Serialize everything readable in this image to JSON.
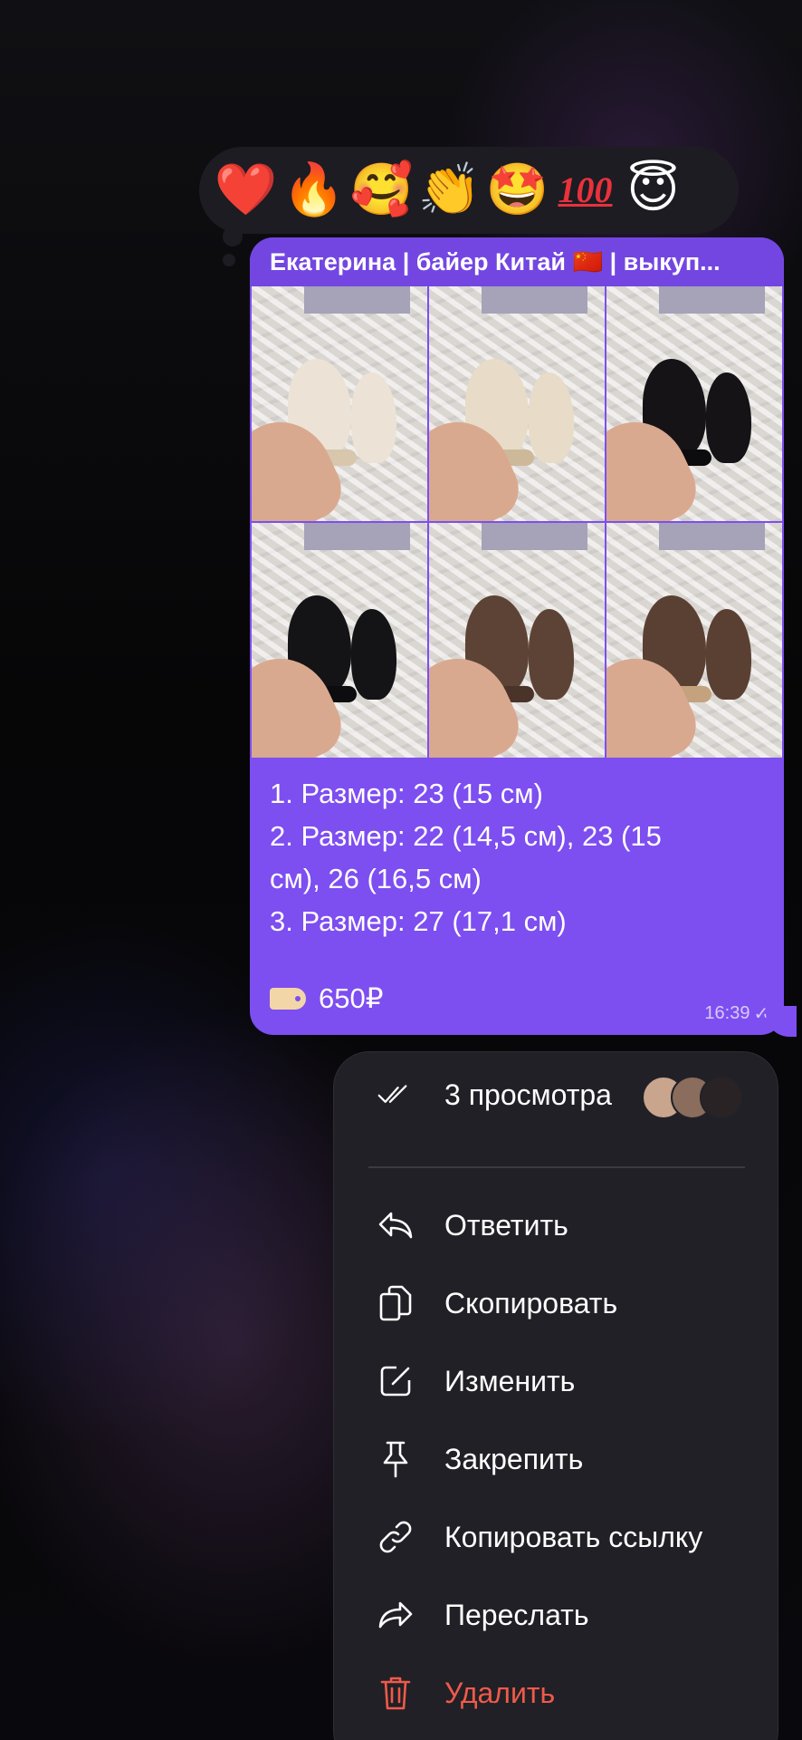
{
  "reactions": [
    {
      "glyph": "❤️",
      "name": "heart"
    },
    {
      "glyph": "🔥",
      "name": "fire"
    },
    {
      "glyph": "🥰",
      "name": "smiling-hearts"
    },
    {
      "glyph": "👏",
      "name": "clap"
    },
    {
      "glyph": "🤩",
      "name": "star-struck"
    },
    {
      "glyph": "100",
      "name": "hundred"
    },
    {
      "glyph": "😇",
      "name": "halo"
    }
  ],
  "message": {
    "sender": "Екатерина | байер Китай 🇨🇳 | выкуп...",
    "photos": [
      {
        "shoe": "#ece3d6",
        "sole": "#d8c7ad"
      },
      {
        "shoe": "#e8dcc8",
        "sole": "#cdb999"
      },
      {
        "shoe": "#151316",
        "sole": "#0c0b0d"
      },
      {
        "shoe": "#141315",
        "sole": "#0d0c0e"
      },
      {
        "shoe": "#5d4336",
        "sole": "#4a342a"
      },
      {
        "shoe": "#5a4033",
        "sole": "#c5a27e"
      }
    ],
    "lines": [
      "1. Размер: 23 (15 см)",
      "2. Размер: 22 (14,5 см), 23 (15",
      "см), 26 (16,5 см)",
      "3. Размер: 27 (17,1 см)"
    ],
    "price": "650₽",
    "time": "16:39",
    "read_mark": "✓✓"
  },
  "menu": {
    "views": "3 просмотра",
    "view_avatars": [
      "#c9a58e",
      "#8a6d5c",
      "#2a2326"
    ],
    "items": [
      {
        "label": "Ответить",
        "icon": "reply-icon"
      },
      {
        "label": "Скопировать",
        "icon": "copy-icon"
      },
      {
        "label": "Изменить",
        "icon": "edit-icon"
      },
      {
        "label": "Закрепить",
        "icon": "pin-icon"
      },
      {
        "label": "Копировать ссылку",
        "icon": "link-icon"
      },
      {
        "label": "Переслать",
        "icon": "forward-icon"
      },
      {
        "label": "Удалить",
        "icon": "trash-icon"
      }
    ]
  },
  "colors": {
    "bubble": "#7d4ef0",
    "menu_bg": "#222128",
    "danger": "#ef5a4a"
  }
}
